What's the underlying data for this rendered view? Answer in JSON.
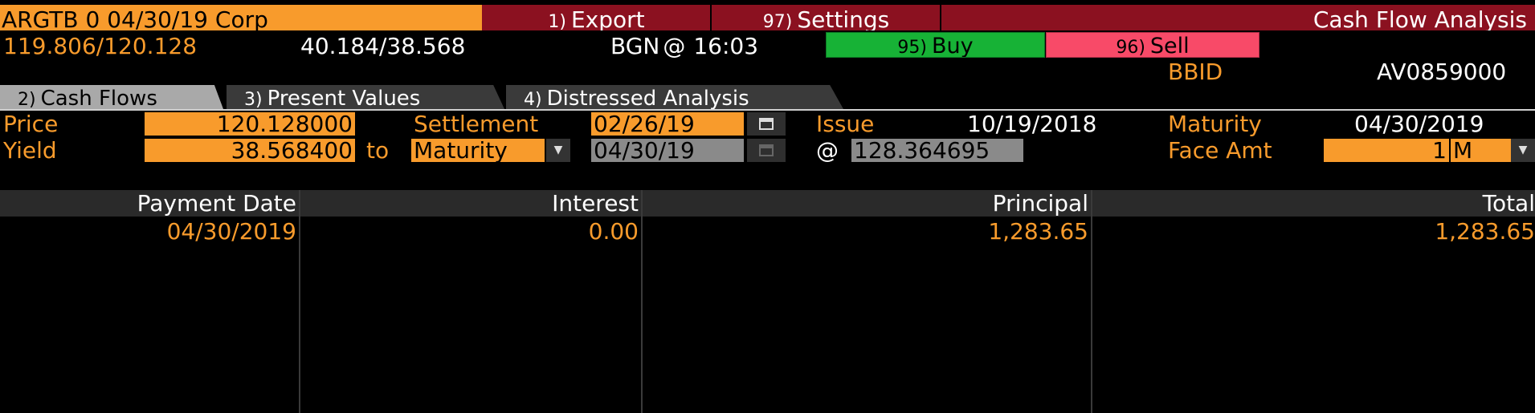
{
  "header": {
    "ticker": "ARGTB 0 04/30/19 Corp",
    "export_num": "1)",
    "export_label": "Export",
    "settings_num": "97)",
    "settings_label": "Settings",
    "title": "Cash Flow Analysis"
  },
  "quote": {
    "price_bid_ask": "119.806/120.128",
    "yield_bid_ask": "40.184/38.568",
    "source": "BGN",
    "at": "@",
    "time": "16:03",
    "buy_num": "95)",
    "buy_label": "Buy",
    "sell_num": "96)",
    "sell_label": "Sell",
    "bbid_label": "BBID",
    "bbid_value": "AV0859000"
  },
  "tabs": [
    {
      "num": "2)",
      "label": "Cash Flows"
    },
    {
      "num": "3)",
      "label": "Present Values"
    },
    {
      "num": "4)",
      "label": "Distressed Analysis"
    }
  ],
  "form": {
    "price_label": "Price",
    "price_value": "120.128000",
    "yield_label": "Yield",
    "yield_value": "38.568400",
    "to_label": "to",
    "workout_value": "Maturity",
    "settlement_label": "Settlement",
    "settlement_value": "02/26/19",
    "workout_date": "04/30/19",
    "at_label": "@",
    "workout_price": "128.364695",
    "issue_label": "Issue",
    "issue_value": "10/19/2018",
    "maturity_label": "Maturity",
    "maturity_value": "04/30/2019",
    "face_label": "Face Amt",
    "face_value": "1",
    "face_unit": "M"
  },
  "table": {
    "headers": [
      "Payment Date",
      "Interest",
      "Principal",
      "Total"
    ],
    "rows": [
      [
        "04/30/2019",
        "0.00",
        "1,283.65",
        "1,283.65"
      ]
    ]
  },
  "colors": {
    "accent_orange": "#f89b2c",
    "header_red": "#8b1120",
    "buy_green": "#17b236",
    "sell_red": "#f84a68"
  }
}
